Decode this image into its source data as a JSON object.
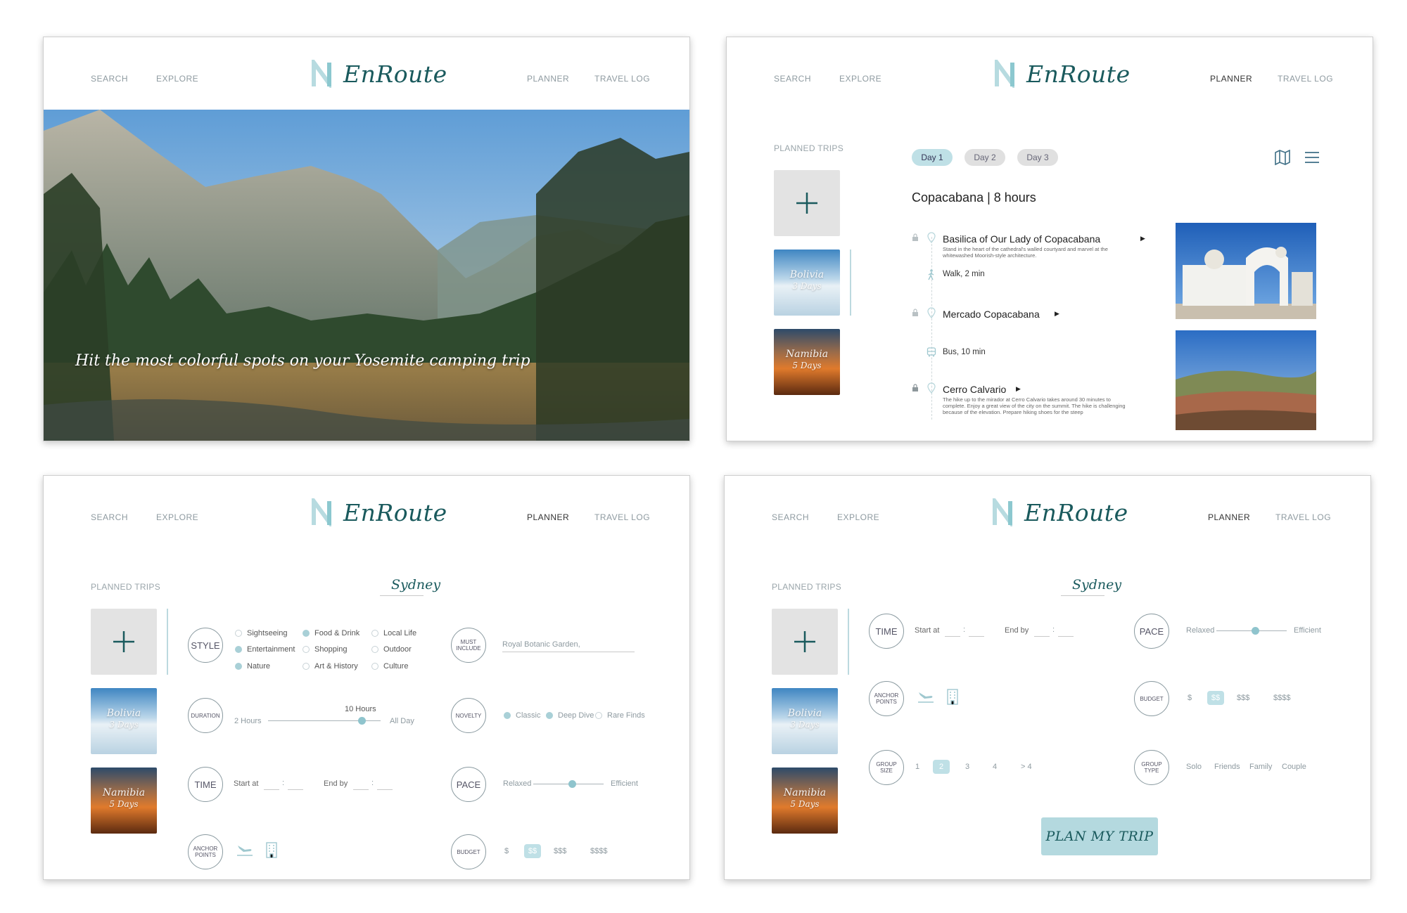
{
  "nav": {
    "search": "SEARCH",
    "explore": "EXPLORE",
    "planner": "PLANNER",
    "travel_log": "TRAVEL LOG",
    "brand": "EnRoute"
  },
  "colors": {
    "brand_teal": "#1a5a5d",
    "accent_light": "#bfe0e6",
    "accent_dot": "#8fc4cd",
    "button_bg": "#b4d9df"
  },
  "home": {
    "hero_caption": "Hit the most colorful spots on your Yosemite camping trip"
  },
  "sidebar": {
    "planned_trips_label": "PLANNED TRIPS",
    "trips": [
      {
        "name": "Bolivia",
        "days": "3 Days"
      },
      {
        "name": "Namibia",
        "days": "5 Days"
      }
    ]
  },
  "itinerary": {
    "days": [
      "Day 1",
      "Day 2",
      "Day 3"
    ],
    "header": "Copacabana | 8 hours",
    "stops": [
      {
        "name": "Basilica of Our Lady of Copacabana",
        "description": "Stand in the heart of the cathedral's walled courtyard and marvel at the whitewashed Moorish-style architecture."
      },
      {
        "name": "Mercado Copacabana",
        "description": ""
      },
      {
        "name": "Cerro Calvario",
        "description": "The hike up to the mirador at Cerro Calvario takes around 30 minutes to complete. Enjoy a great view of the city on the summit. The hike is challenging because of the elevation. Prepare hiking shoes for the steep"
      }
    ],
    "transits": [
      "Walk, 2 min",
      "Bus, 10 min"
    ]
  },
  "planner": {
    "city": "Sydney",
    "style": {
      "label": "STYLE",
      "options": [
        {
          "label": "Sightseeing",
          "selected": false
        },
        {
          "label": "Food & Drink",
          "selected": true
        },
        {
          "label": "Local Life",
          "selected": false
        },
        {
          "label": "Entertainment",
          "selected": true
        },
        {
          "label": "Shopping",
          "selected": false
        },
        {
          "label": "Outdoor",
          "selected": false
        },
        {
          "label": "Nature",
          "selected": true
        },
        {
          "label": "Art & History",
          "selected": false
        },
        {
          "label": "Culture",
          "selected": false
        }
      ]
    },
    "duration": {
      "label": "DURATION",
      "min": "2 Hours",
      "max": "All Day",
      "value": "10 Hours",
      "fraction": 0.83
    },
    "time": {
      "label": "TIME",
      "start_label": "Start at",
      "end_label": "End by",
      "separator": ":"
    },
    "anchor": {
      "label_line1": "ANCHOR",
      "label_line2": "POINTS",
      "icons": [
        "plane-landing-icon",
        "hotel-building-icon"
      ]
    },
    "must_include": {
      "label_line1": "MUST",
      "label_line2": "INCLUDE",
      "value": "Royal Botanic Garden,"
    },
    "novelty": {
      "label": "NOVELTY",
      "options": [
        {
          "label": "Classic",
          "selected": true
        },
        {
          "label": "Deep Dive",
          "selected": true
        },
        {
          "label": "Rare Finds",
          "selected": false
        }
      ]
    },
    "pace": {
      "label": "PACE",
      "min": "Relaxed",
      "max": "Efficient",
      "fraction": 0.55
    },
    "budget": {
      "label": "BUDGET",
      "options": [
        "$",
        "$$",
        "$$$",
        "$$$$"
      ],
      "selected": "$$"
    },
    "group_size": {
      "label_line1": "GROUP",
      "label_line2": "SIZE",
      "options": [
        "1",
        "2",
        "3",
        "4",
        "> 4"
      ],
      "selected": "2"
    },
    "group_type": {
      "label_line1": "GROUP",
      "label_line2": "TYPE",
      "options": [
        "Solo",
        "Friends",
        "Family",
        "Couple"
      ]
    },
    "cta": "PLAN MY TRIP"
  }
}
